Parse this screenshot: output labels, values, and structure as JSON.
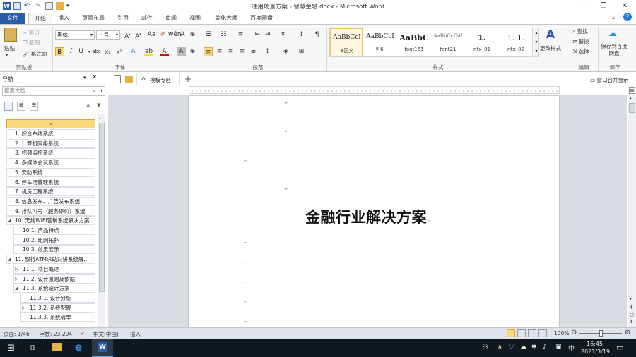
{
  "window": {
    "title": "通用场景方案 - 智慧金融.docx - Microsoft Word",
    "minimize": "—",
    "restore": "❐",
    "close": "✕"
  },
  "tabs": [
    "文件",
    "开始",
    "插入",
    "页面布局",
    "引用",
    "邮件",
    "审阅",
    "视图",
    "美化大师",
    "百度网盘"
  ],
  "ribbon": {
    "clipboard": {
      "paste": "粘贴",
      "cut": "剪切",
      "copy": "复制",
      "format_painter": "格式刷",
      "label": "剪贴板"
    },
    "font": {
      "name": "黑体",
      "size": "一号",
      "label": "字体"
    },
    "paragraph": {
      "label": "段落"
    },
    "styles": {
      "items": [
        {
          "sample": "AaBbCcI",
          "name": "¥正文"
        },
        {
          "sample": "AaBbCcI",
          "name": "¥ 6'"
        },
        {
          "sample": "AaBbC",
          "name": "font161"
        },
        {
          "sample": "AaBbCcDdI",
          "name": "font21"
        },
        {
          "sample": "1.",
          "name": "rjtx_01"
        },
        {
          "sample": "1. 1.",
          "name": "rjtx_02"
        }
      ],
      "change": "更改样式",
      "label": "样式"
    },
    "editing": {
      "find": "查找",
      "replace": "替换",
      "select": "选择",
      "label": "编辑"
    },
    "save": {
      "button": "保存到百度网盘",
      "label": "保存"
    }
  },
  "nav": {
    "title": "导航",
    "search_placeholder": "搜索文档",
    "items": [
      {
        "label": "1. 综合布线系统",
        "level": 1
      },
      {
        "label": "2. 计算机网络系统",
        "level": 1
      },
      {
        "label": "3. 视频监控系统",
        "level": 1
      },
      {
        "label": "4. 多媒体会议系统",
        "level": 1
      },
      {
        "label": "5. 安防系统",
        "level": 1
      },
      {
        "label": "6. 停车场管理系统",
        "level": 1
      },
      {
        "label": "7. 机房工程系统",
        "level": 1
      },
      {
        "label": "8. 信息发布、广告发布系统",
        "level": 1
      },
      {
        "label": "9. 排队叫号（服务评价）系统",
        "level": 1
      },
      {
        "label": "10. 无线WIFI营销系统解决方案",
        "level": 1
      },
      {
        "label": "10.1. 产品特点",
        "level": 2
      },
      {
        "label": "10.2. 组网拓扑",
        "level": 2
      },
      {
        "label": "10.3. 效果展示",
        "level": 2
      },
      {
        "label": "11. 银行ATM求助对讲系统解...",
        "level": 1
      },
      {
        "label": "11.1. 项目概述",
        "level": 2
      },
      {
        "label": "11.2. 设计原则及依据",
        "level": 2
      },
      {
        "label": "11.3. 系统设计方案",
        "level": 2
      },
      {
        "label": "11.3.1. 设计分析",
        "level": 3
      },
      {
        "label": "11.3.2. 系统配置",
        "level": 3
      },
      {
        "label": "11.3.3. 系统清单",
        "level": 3
      }
    ]
  },
  "doctabs": {
    "template": "模板专区",
    "window_merge": "窗口合并显示"
  },
  "document": {
    "heading": "金融行业解决方案",
    "para_mark": "↵"
  },
  "status": {
    "page": "页面: 1/46",
    "words": "字数: 23,294",
    "lang": "中文(中国)",
    "insert": "插入",
    "zoom": "100%"
  },
  "taskbar": {
    "time": "16:45",
    "date": "2021/3/19",
    "ime": "中"
  }
}
